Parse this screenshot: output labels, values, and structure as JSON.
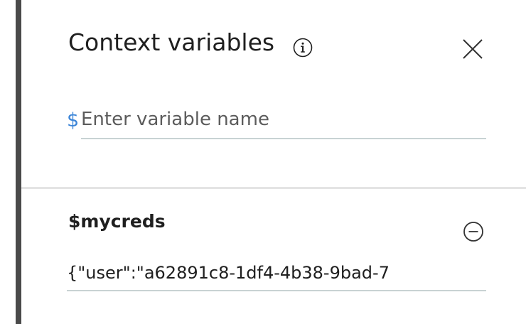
{
  "panel": {
    "title": "Context variables",
    "icons": {
      "info": "info-icon",
      "close": "close-icon",
      "remove": "minus-circle-icon"
    }
  },
  "new_variable": {
    "prefix": "$",
    "placeholder": "Enter variable name",
    "value": ""
  },
  "variables": [
    {
      "name": "$mycreds",
      "value": "{\"user\":\"a62891c8-1df4-4b38-9bad-7"
    }
  ],
  "colors": {
    "accent_blue": "#3d86d8",
    "underline": "#c8d2d3",
    "divider": "#e4e4e4",
    "left_rail": "#4a4a4a",
    "text": "#1f1f1f"
  }
}
